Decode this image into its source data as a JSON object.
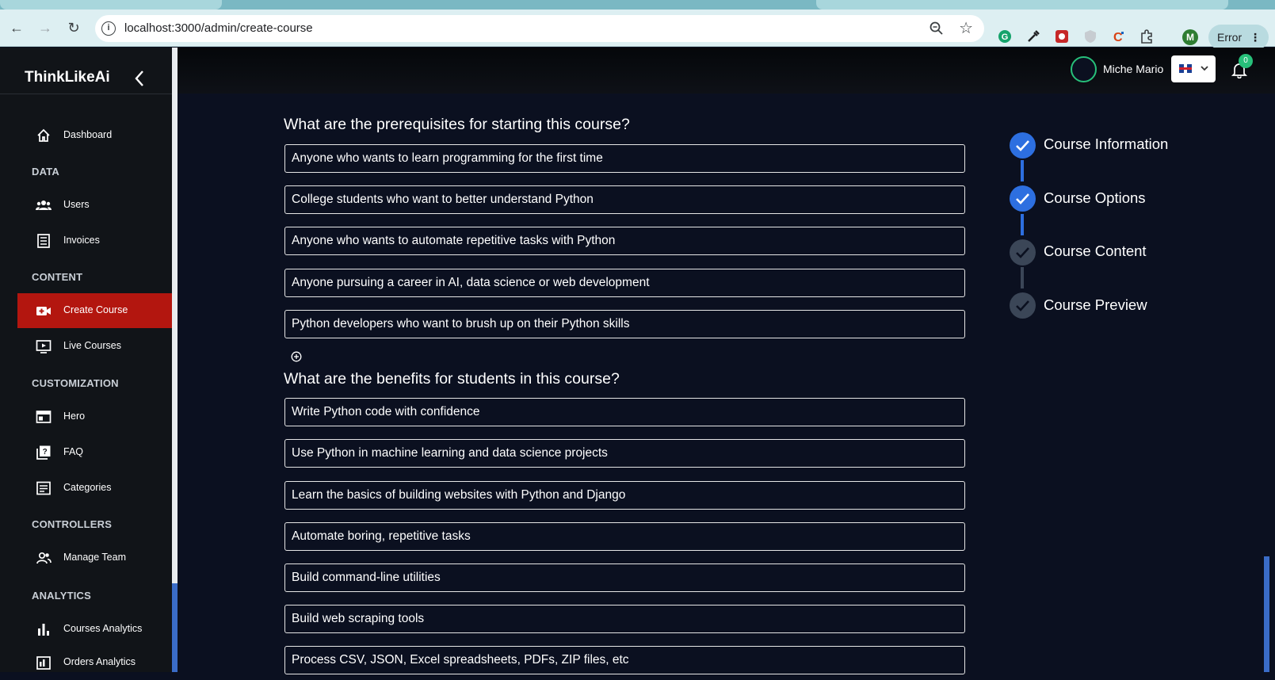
{
  "browser": {
    "url": "localhost:3000/admin/create-course",
    "error_label": "Error",
    "profile_initial": "M"
  },
  "sidebar": {
    "brand": "ThinkLikeAi",
    "items": [
      {
        "label": "Dashboard",
        "icon": "home-icon"
      },
      {
        "label": "Users",
        "icon": "users-icon"
      },
      {
        "label": "Invoices",
        "icon": "invoice-icon"
      },
      {
        "label": "Create Course",
        "icon": "video-add-icon",
        "active": true
      },
      {
        "label": "Live Courses",
        "icon": "monitor-play-icon"
      },
      {
        "label": "Hero",
        "icon": "web-icon"
      },
      {
        "label": "FAQ",
        "icon": "quiz-icon"
      },
      {
        "label": "Categories",
        "icon": "category-icon"
      },
      {
        "label": "Manage Team",
        "icon": "team-icon"
      },
      {
        "label": "Courses Analytics",
        "icon": "bar-chart-icon"
      },
      {
        "label": "Orders Analytics",
        "icon": "orders-chart-icon"
      }
    ],
    "sections": [
      "DATA",
      "CONTENT",
      "CUSTOMIZATION",
      "CONTROLLERS",
      "ANALYTICS"
    ]
  },
  "header": {
    "user_name": "Miche Mario",
    "notification_count": "0"
  },
  "form": {
    "prerequisites_question": "What are the prerequisites for starting this course?",
    "prerequisites": [
      "Anyone who wants to learn programming for the first time",
      "College students who want to better understand Python",
      "Anyone who wants to automate repetitive tasks with Python",
      "Anyone pursuing a career in AI, data science or web development",
      "Python developers who want to brush up on their Python skills"
    ],
    "benefits_question": "What are the benefits for students in this course?",
    "benefits": [
      "Write Python code with confidence",
      "Use Python in machine learning and data science projects",
      "Learn the basics of building websites with Python and Django",
      "Automate boring, repetitive tasks",
      "Build command-line utilities",
      "Build web scraping tools",
      "Process CSV, JSON, Excel spreadsheets, PDFs, ZIP files, etc"
    ]
  },
  "stepper": {
    "steps": [
      {
        "label": "Course Information",
        "done": true
      },
      {
        "label": "Course Options",
        "done": true
      },
      {
        "label": "Course Content",
        "done": false
      },
      {
        "label": "Course Preview",
        "done": false
      }
    ],
    "done_color": "#2d6fe0",
    "pending_color": "#3b4657"
  },
  "colors": {
    "active_nav": "#b3160f",
    "accent_green": "#27c07a",
    "background": "#0b1020"
  }
}
